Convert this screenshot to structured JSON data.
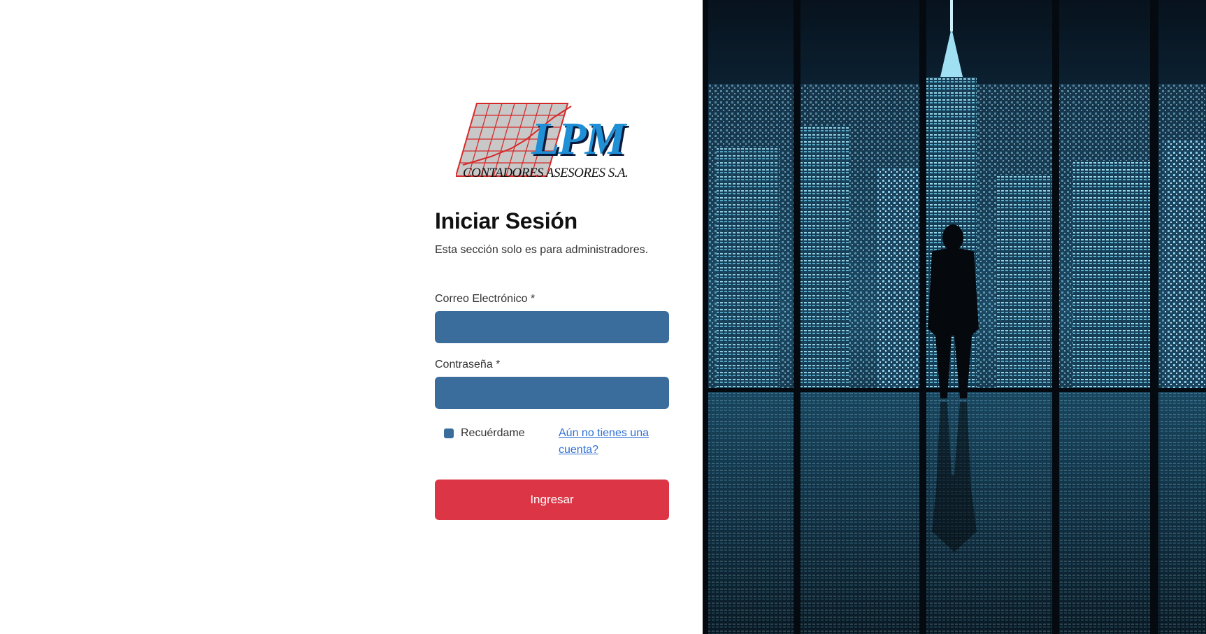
{
  "logo": {
    "brand": "LPM",
    "subtitle": "CONTADORES ASESORES S.A."
  },
  "login": {
    "title": "Iniciar Sesión",
    "subtitle": "Esta sección solo es para administradores.",
    "email_label": "Correo Electrónico *",
    "email_value": "",
    "password_label": "Contraseña *",
    "password_value": "",
    "remember_label": "Recuérdame",
    "remember_checked": false,
    "register_link": "Aún no tienes una cuenta?",
    "submit_label": "Ingresar"
  },
  "colors": {
    "input_bg": "#3a6c9c",
    "submit_bg": "#dc3545",
    "link": "#2f6fd6"
  },
  "background_image": "city-skyline-night-businessman"
}
